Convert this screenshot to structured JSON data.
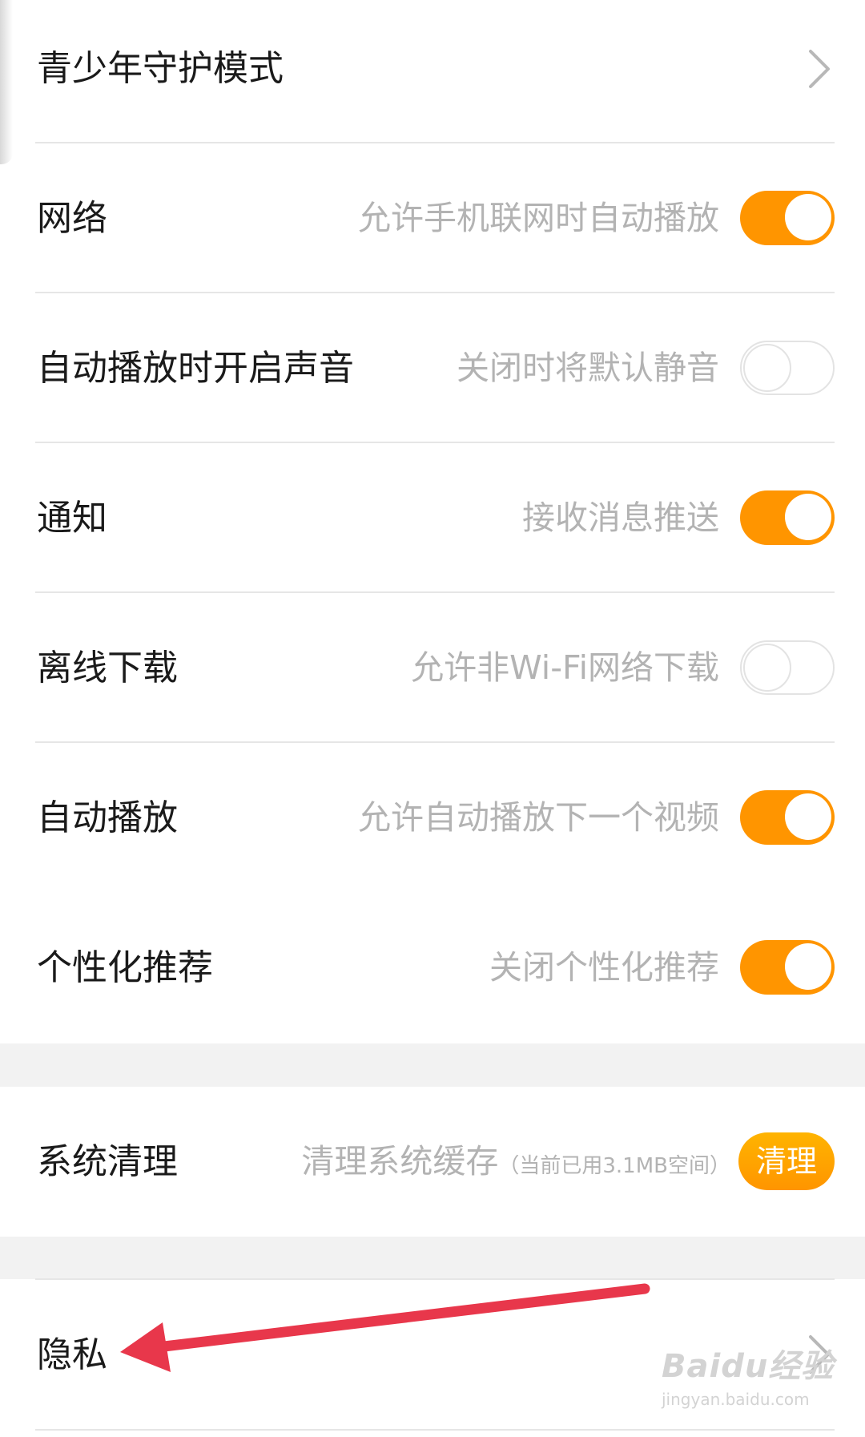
{
  "settings": {
    "rows": [
      {
        "title": "青少年守护模式",
        "control": "chevron"
      },
      {
        "title": "网络",
        "desc": "允许手机联网时自动播放",
        "control": "toggle",
        "state": "on"
      },
      {
        "title": "自动播放时开启声音",
        "desc": "关闭时将默认静音",
        "control": "toggle",
        "state": "off"
      },
      {
        "title": "通知",
        "desc": "接收消息推送",
        "control": "toggle",
        "state": "on"
      },
      {
        "title": "离线下载",
        "desc": "允许非Wi-Fi网络下载",
        "control": "toggle",
        "state": "off"
      },
      {
        "title": "自动播放",
        "desc": "允许自动播放下一个视频",
        "control": "toggle",
        "state": "on"
      },
      {
        "title": "个性化推荐",
        "desc": "关闭个性化推荐",
        "control": "toggle",
        "state": "on"
      }
    ],
    "system": {
      "title": "系统清理",
      "desc": "清理系统缓存",
      "note": "（当前已用3.1MB空间）",
      "button_label": "清理"
    },
    "privacy": {
      "title": "隐私",
      "control": "chevron"
    }
  },
  "colors": {
    "accent": "#ff9500",
    "annotation_arrow": "#e8374b",
    "section_gap": "#f2f2f2",
    "desc_text": "#b3b3b3"
  },
  "watermark": {
    "logo": "Baidu经验",
    "url": "jingyan.baidu.com"
  }
}
